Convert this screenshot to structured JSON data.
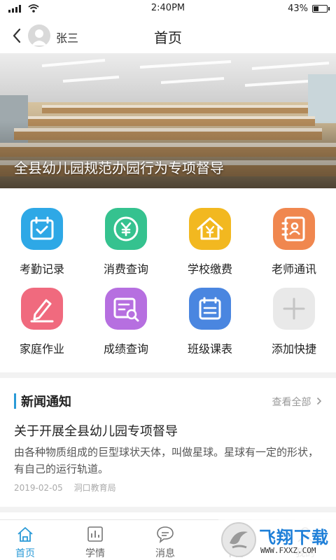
{
  "status_bar": {
    "time": "2:40PM",
    "battery": "43%",
    "battery_level": 0.43
  },
  "navbar": {
    "user_name": "张三",
    "title": "首页"
  },
  "banner": {
    "caption": "全县幼儿园规范办园行为专项督导"
  },
  "grid": {
    "items": [
      {
        "label": "考勤记录",
        "icon": "calendar-check-icon",
        "color": "#2ea8e6"
      },
      {
        "label": "消费查询",
        "icon": "yuan-coin-icon",
        "color": "#35c28f"
      },
      {
        "label": "学校缴费",
        "icon": "house-yuan-icon",
        "color": "#f2b820"
      },
      {
        "label": "老师通讯",
        "icon": "contact-book-icon",
        "color": "#f0874f"
      },
      {
        "label": "家庭作业",
        "icon": "pencil-icon",
        "color": "#f06a7e"
      },
      {
        "label": "成绩查询",
        "icon": "report-search-icon",
        "color": "#b66fe0"
      },
      {
        "label": "班级课表",
        "icon": "schedule-list-icon",
        "color": "#4a86e0"
      },
      {
        "label": "添加快捷",
        "icon": "plus-icon",
        "color": "#e9e9e9"
      }
    ]
  },
  "news": {
    "section_title": "新闻通知",
    "view_all": "查看全部",
    "items": [
      {
        "headline": "关于开展全县幼儿园专项督导",
        "summary": "由各种物质组成的巨型球状天体，叫做星球。星球有一定的形状，有自己的运行轨道。",
        "date": "2019-02-05",
        "source": "洞口教育局"
      }
    ]
  },
  "tabbar": {
    "tabs": [
      {
        "label": "首页",
        "icon": "home-icon",
        "active": true
      },
      {
        "label": "学情",
        "icon": "bar-chart-icon",
        "active": false
      },
      {
        "label": "消息",
        "icon": "chat-bubble-icon",
        "active": false
      },
      {
        "label": "下务",
        "icon": "tasks-icon",
        "active": false
      },
      {
        "label": "我的",
        "icon": "profile-icon",
        "active": false
      }
    ],
    "active_color": "#2a9ad7"
  },
  "watermark": {
    "text": "飞翔下载",
    "url": "WWW.FXXZ.COM"
  }
}
